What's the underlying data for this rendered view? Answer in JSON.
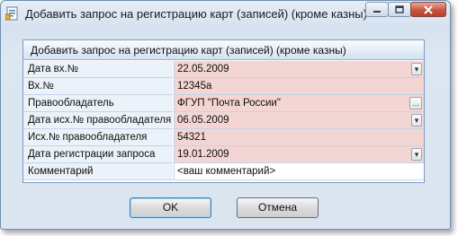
{
  "window": {
    "title": "Добавить запрос на регистрацию карт (записей) (кроме казны)"
  },
  "panel": {
    "header": "Добавить запрос на регистрацию карт (записей) (кроме казны)",
    "rows": [
      {
        "label": "Дата вх.№",
        "value": "22.05.2009",
        "required": true,
        "button": "dropdown"
      },
      {
        "label": "Вх.№",
        "value": "12345a",
        "required": true,
        "button": ""
      },
      {
        "label": "Правообладатель",
        "value": "ФГУП \"Почта России\"",
        "required": true,
        "button": "ellipsis"
      },
      {
        "label": "Дата исх.№ правообладателя",
        "value": "06.05.2009",
        "required": true,
        "button": "dropdown"
      },
      {
        "label": "Исх.№ правообладателя",
        "value": "54321",
        "required": true,
        "button": ""
      },
      {
        "label": "Дата регистрации запроса",
        "value": "19.01.2009",
        "required": true,
        "button": "dropdown"
      },
      {
        "label": "Комментарий",
        "value": "<ваш комментарий>",
        "required": false,
        "button": ""
      }
    ]
  },
  "buttons": {
    "ok": "OK",
    "cancel": "Отмена"
  },
  "icons": {
    "dropdown": "▾",
    "ellipsis": "..."
  },
  "colors": {
    "required_field": "#f3d6d3",
    "label_cell": "#ecf2f9",
    "close_button": "#c9543f"
  }
}
